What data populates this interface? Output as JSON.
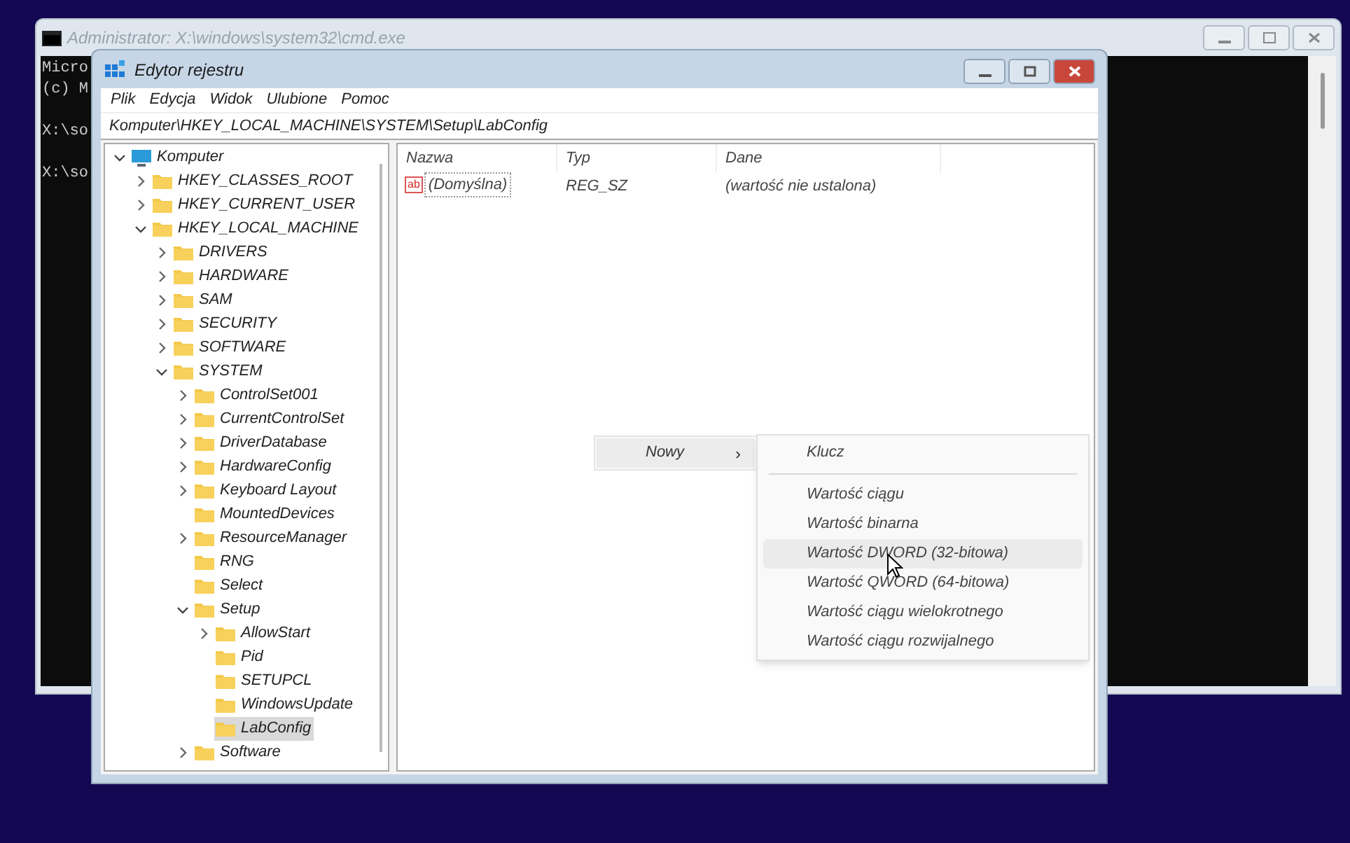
{
  "console_window": {
    "title": "Administrator: X:\\windows\\system32\\cmd.exe",
    "lines": [
      {
        "kind": "output",
        "text": "Micro"
      },
      {
        "kind": "output",
        "text": "(c) M"
      },
      {
        "kind": "prompt",
        "text": "X:\\so"
      },
      {
        "kind": "prompt",
        "text": "X:\\so"
      }
    ]
  },
  "registry_window": {
    "title": "Edytor rejestru",
    "menu": [
      "Plik",
      "Edycja",
      "Widok",
      "Ulubione",
      "Pomoc"
    ],
    "address": "Komputer\\HKEY_LOCAL_MACHINE\\SYSTEM\\Setup\\LabConfig",
    "tree": [
      {
        "label": "Komputer",
        "kind": "computer",
        "expanded": true,
        "selected": false,
        "children": [
          {
            "label": "HKEY_CLASSES_ROOT",
            "kind": "key",
            "expanded": false,
            "selected": false
          },
          {
            "label": "HKEY_CURRENT_USER",
            "kind": "key",
            "expanded": false,
            "selected": false
          },
          {
            "label": "HKEY_LOCAL_MACHINE",
            "kind": "key",
            "expanded": true,
            "selected": false,
            "children": [
              {
                "label": "DRIVERS",
                "kind": "key",
                "expanded": false,
                "selected": false
              },
              {
                "label": "HARDWARE",
                "kind": "key",
                "expanded": false,
                "selected": false
              },
              {
                "label": "SAM",
                "kind": "key",
                "expanded": false,
                "selected": false
              },
              {
                "label": "SECURITY",
                "kind": "key",
                "expanded": false,
                "selected": false
              },
              {
                "label": "SOFTWARE",
                "kind": "key",
                "expanded": false,
                "selected": false
              },
              {
                "label": "SYSTEM",
                "kind": "key",
                "expanded": true,
                "selected": false,
                "children": [
                  {
                    "label": "ControlSet001",
                    "kind": "key",
                    "expanded": false,
                    "selected": false
                  },
                  {
                    "label": "CurrentControlSet",
                    "kind": "key",
                    "expanded": false,
                    "selected": false
                  },
                  {
                    "label": "DriverDatabase",
                    "kind": "key",
                    "expanded": false,
                    "selected": false
                  },
                  {
                    "label": "HardwareConfig",
                    "kind": "key",
                    "expanded": false,
                    "selected": false
                  },
                  {
                    "label": "Keyboard Layout",
                    "kind": "key",
                    "expanded": false,
                    "selected": false
                  },
                  {
                    "label": "MountedDevices",
                    "kind": "key",
                    "selected": false
                  },
                  {
                    "label": "ResourceManager",
                    "kind": "key",
                    "expanded": false,
                    "selected": false
                  },
                  {
                    "label": "RNG",
                    "kind": "key",
                    "selected": false
                  },
                  {
                    "label": "Select",
                    "kind": "key",
                    "selected": false
                  },
                  {
                    "label": "Setup",
                    "kind": "key",
                    "expanded": true,
                    "selected": false,
                    "children": [
                      {
                        "label": "AllowStart",
                        "kind": "key",
                        "expanded": false,
                        "selected": false
                      },
                      {
                        "label": "Pid",
                        "kind": "key",
                        "selected": false
                      },
                      {
                        "label": "SETUPCL",
                        "kind": "key",
                        "selected": false
                      },
                      {
                        "label": "WindowsUpdate",
                        "kind": "key",
                        "selected": false
                      },
                      {
                        "label": "LabConfig",
                        "kind": "key",
                        "selected": true
                      }
                    ]
                  },
                  {
                    "label": "Software",
                    "kind": "key",
                    "expanded": false,
                    "selected": false
                  }
                ]
              }
            ]
          }
        ]
      }
    ],
    "table": {
      "columns": [
        "Nazwa",
        "Typ",
        "Dane"
      ],
      "rows": [
        {
          "icon": "ab",
          "name": "(Domyślna)",
          "type": "REG_SZ",
          "data": "(wartość nie ustalona)"
        }
      ]
    },
    "context_menu": {
      "items": [
        {
          "label": "Nowy",
          "chevron": "›",
          "highlighted": true
        }
      ]
    },
    "submenu": {
      "items": [
        {
          "kind": "item",
          "label": "Klucz",
          "highlighted": false
        },
        {
          "kind": "separator"
        },
        {
          "kind": "item",
          "label": "Wartość ciągu",
          "highlighted": false
        },
        {
          "kind": "item",
          "label": "Wartość binarna",
          "highlighted": false
        },
        {
          "kind": "item",
          "label": "Wartość DWORD (32-bitowa)",
          "highlighted": true
        },
        {
          "kind": "item",
          "label": "Wartość QWORD (64-bitowa)",
          "highlighted": false
        },
        {
          "kind": "item",
          "label": "Wartość ciągu wielokrotnego",
          "highlighted": false
        },
        {
          "kind": "item",
          "label": "Wartość ciągu rozwijalnego",
          "highlighted": false
        }
      ]
    }
  }
}
